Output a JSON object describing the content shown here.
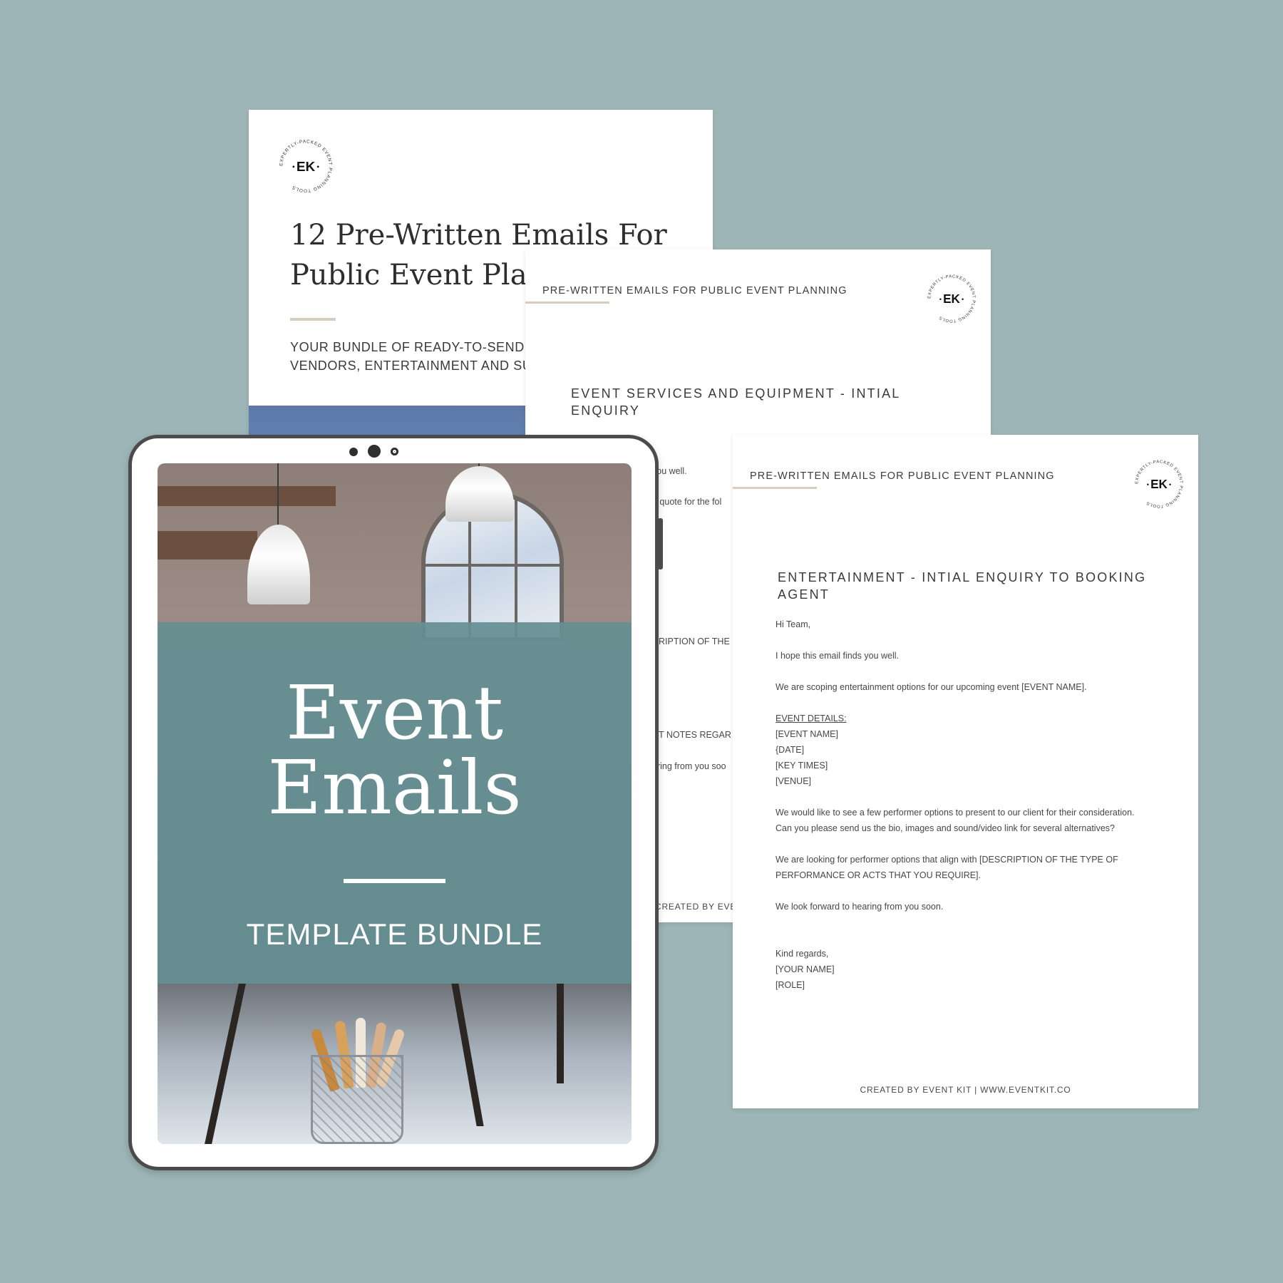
{
  "colors": {
    "background": "#9db5b7",
    "band": "#658f92",
    "accent_rule": "#d9cdbf",
    "tablet_frame": "#4b4b4b"
  },
  "logo": {
    "letters": "EK",
    "ring_text": "EXPERTLY-PACKED EVENT PLANNING TOOLS"
  },
  "cover": {
    "title_line1": "12 Pre-Written Emails For",
    "title_line2": "Public Event Plan",
    "subtitle_line1": "YOUR BUNDLE OF READY-TO-SEND",
    "subtitle_line2": "VENDORS, ENTERTAINMENT AND SU"
  },
  "page2": {
    "header": "PRE-WRITTEN EMAILS FOR PUBLIC EVENT PLANNING",
    "section_title": "EVENT SERVICES AND EQUIPMENT - INTIAL ENQUIRY",
    "fragments": [
      "you well.",
      "a quote for the fol",
      "CRIPTION OF THE",
      "NT NOTES REGAR",
      "aring from you soo",
      "CREATED BY EVE"
    ]
  },
  "page3": {
    "header": "PRE-WRITTEN EMAILS FOR PUBLIC EVENT PLANNING",
    "section_title": "ENTERTAINMENT - INTIAL ENQUIRY TO BOOKING AGENT",
    "body": {
      "greeting": "Hi Team,",
      "line1": "I hope this email finds you well.",
      "line2": "We are scoping entertainment options for our upcoming event [EVENT NAME].",
      "details_heading": "EVENT DETAILS:",
      "detail1": "[EVENT NAME]",
      "detail2": "{DATE]",
      "detail3": "[KEY TIMES]",
      "detail4": "[VENUE]",
      "line3a": "We would like to see a few performer options to present to our client for their consideration.",
      "line3b": "Can you please send us the bio, images and sound/video link for several alternatives?",
      "line4a": "We are looking for performer options that align with [DESCRIPTION OF THE TYPE OF",
      "line4b": "PERFORMANCE OR ACTS THAT YOU REQUIRE].",
      "line5": "We look forward to hearing from you soon.",
      "signoff": "Kind regards,",
      "name": "[YOUR NAME]",
      "role": "[ROLE]"
    },
    "footer": "CREATED BY EVENT KIT  |  WWW.EVENTKIT.CO"
  },
  "tablet": {
    "title_line1": "Event",
    "title_line2": "Emails",
    "subtitle": "TEMPLATE BUNDLE"
  }
}
